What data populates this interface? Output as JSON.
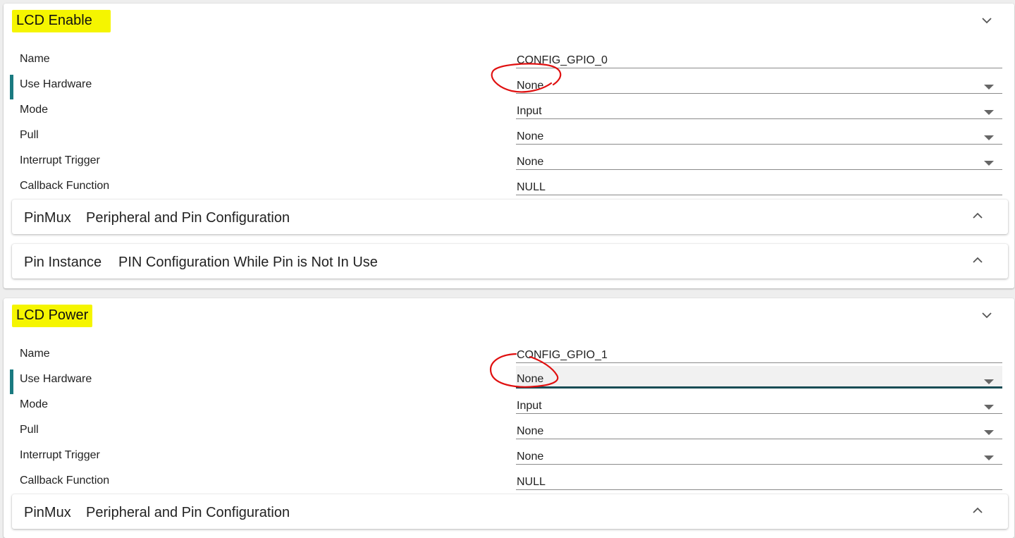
{
  "sections": [
    {
      "title": "LCD Enable",
      "fields": [
        {
          "label": "Name",
          "value": "CONFIG_GPIO_0",
          "type": "text"
        },
        {
          "label": "Use Hardware",
          "value": "None",
          "type": "select"
        },
        {
          "label": "Mode",
          "value": "Input",
          "type": "select"
        },
        {
          "label": "Pull",
          "value": "None",
          "type": "select"
        },
        {
          "label": "Interrupt Trigger",
          "value": "None",
          "type": "select"
        },
        {
          "label": "Callback Function",
          "value": "NULL",
          "type": "text"
        }
      ],
      "subpanels": [
        {
          "title": "PinMux",
          "description": "Peripheral and Pin Configuration"
        },
        {
          "title": "Pin Instance",
          "description": "PIN Configuration While Pin is Not In Use"
        }
      ]
    },
    {
      "title": "LCD Power",
      "fields": [
        {
          "label": "Name",
          "value": "CONFIG_GPIO_1",
          "type": "text"
        },
        {
          "label": "Use Hardware",
          "value": "None",
          "type": "select"
        },
        {
          "label": "Mode",
          "value": "Input",
          "type": "select"
        },
        {
          "label": "Pull",
          "value": "None",
          "type": "select"
        },
        {
          "label": "Interrupt Trigger",
          "value": "None",
          "type": "select"
        },
        {
          "label": "Callback Function",
          "value": "NULL",
          "type": "text"
        }
      ],
      "subpanels": [
        {
          "title": "PinMux",
          "description": "Peripheral and Pin Configuration"
        }
      ]
    }
  ],
  "colors": {
    "highlight": "#f5f500",
    "marker": "#1a7a80",
    "active_underline": "#184c55",
    "annotation": "#e01010"
  },
  "icons": {
    "section_toggle": "chevron-down-icon",
    "subpanel_toggle": "chevron-up-icon",
    "select_arrow": "caret-down-icon"
  }
}
